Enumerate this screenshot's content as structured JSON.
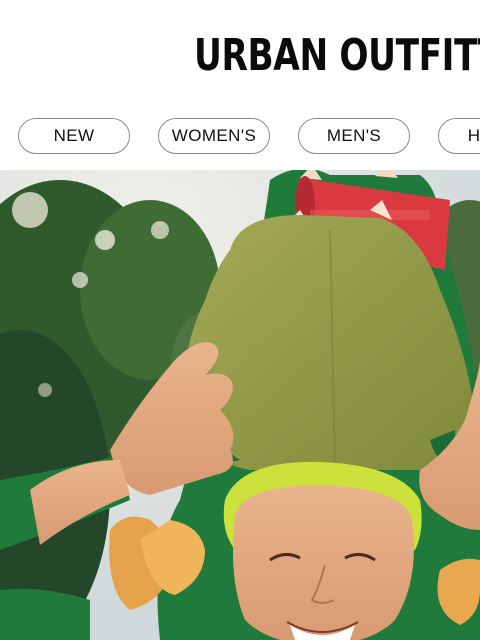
{
  "header": {
    "brand": "URBAN OUTFITTERS"
  },
  "nav": {
    "items": [
      {
        "label": "NEW"
      },
      {
        "label": "WOMEN'S"
      },
      {
        "label": "MEN'S"
      },
      {
        "label": "HOME"
      }
    ]
  },
  "colors": {
    "text": "#0b0b0b",
    "pill_border": "#8a8a8a",
    "costume_green": "#1f7a3c",
    "costume_olive": "#8f9a42",
    "cup_red": "#d83a3f"
  }
}
